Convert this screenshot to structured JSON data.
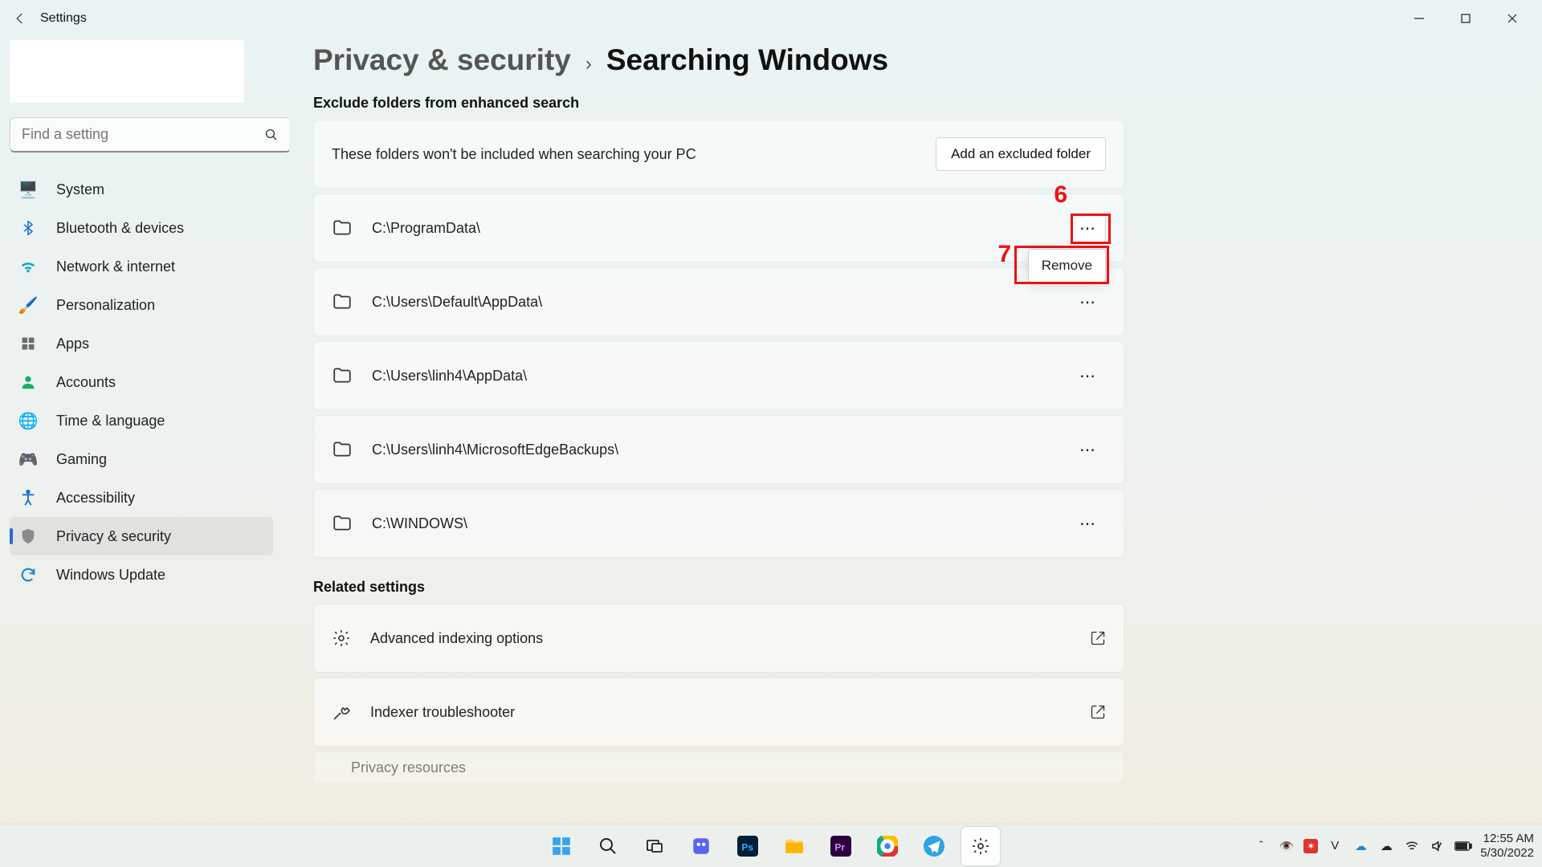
{
  "window": {
    "title": "Settings"
  },
  "search": {
    "placeholder": "Find a setting"
  },
  "sidebar": {
    "items": [
      {
        "label": "System",
        "icon": "💻",
        "color": "#2a7bd3"
      },
      {
        "label": "Bluetooth & devices",
        "icon": "ᛒ",
        "color": "#2a7bd3"
      },
      {
        "label": "Network & internet",
        "icon": "📶",
        "color": "#1aa3c7"
      },
      {
        "label": "Personalization",
        "icon": "🖌️",
        "color": "#b06a2c"
      },
      {
        "label": "Apps",
        "icon": "▦",
        "color": "#6b6b6b"
      },
      {
        "label": "Accounts",
        "icon": "👤",
        "color": "#1fab67"
      },
      {
        "label": "Time & language",
        "icon": "🌐",
        "color": "#3a8bd8"
      },
      {
        "label": "Gaming",
        "icon": "🎮",
        "color": "#6b6b6b"
      },
      {
        "label": "Accessibility",
        "icon": "✖人",
        "color": "#1173d4",
        "access": true
      },
      {
        "label": "Privacy & security",
        "icon": "🛡️",
        "color": "#6b6b6b",
        "active": true
      },
      {
        "label": "Windows Update",
        "icon": "↻",
        "color": "#1a89d6"
      }
    ]
  },
  "breadcrumb": {
    "parent": "Privacy & security",
    "current": "Searching Windows"
  },
  "exclude": {
    "title": "Exclude folders from enhanced search",
    "desc": "These folders won't be included when searching your PC",
    "add_label": "Add an excluded folder",
    "folders": [
      "C:\\ProgramData\\",
      "C:\\Users\\Default\\AppData\\",
      "C:\\Users\\linh4\\AppData\\",
      "C:\\Users\\linh4\\MicrosoftEdgeBackups\\",
      "C:\\WINDOWS\\"
    ]
  },
  "context_menu": {
    "remove": "Remove"
  },
  "annotations": {
    "six": "6",
    "seven": "7"
  },
  "related": {
    "title": "Related settings",
    "items": [
      {
        "label": "Advanced indexing options",
        "icon": "gear"
      },
      {
        "label": "Indexer troubleshooter",
        "icon": "wrench"
      },
      {
        "label": "Privacy resources",
        "icon": "doc"
      }
    ]
  },
  "tray": {
    "time": "12:55 AM",
    "date": "5/30/2022"
  }
}
